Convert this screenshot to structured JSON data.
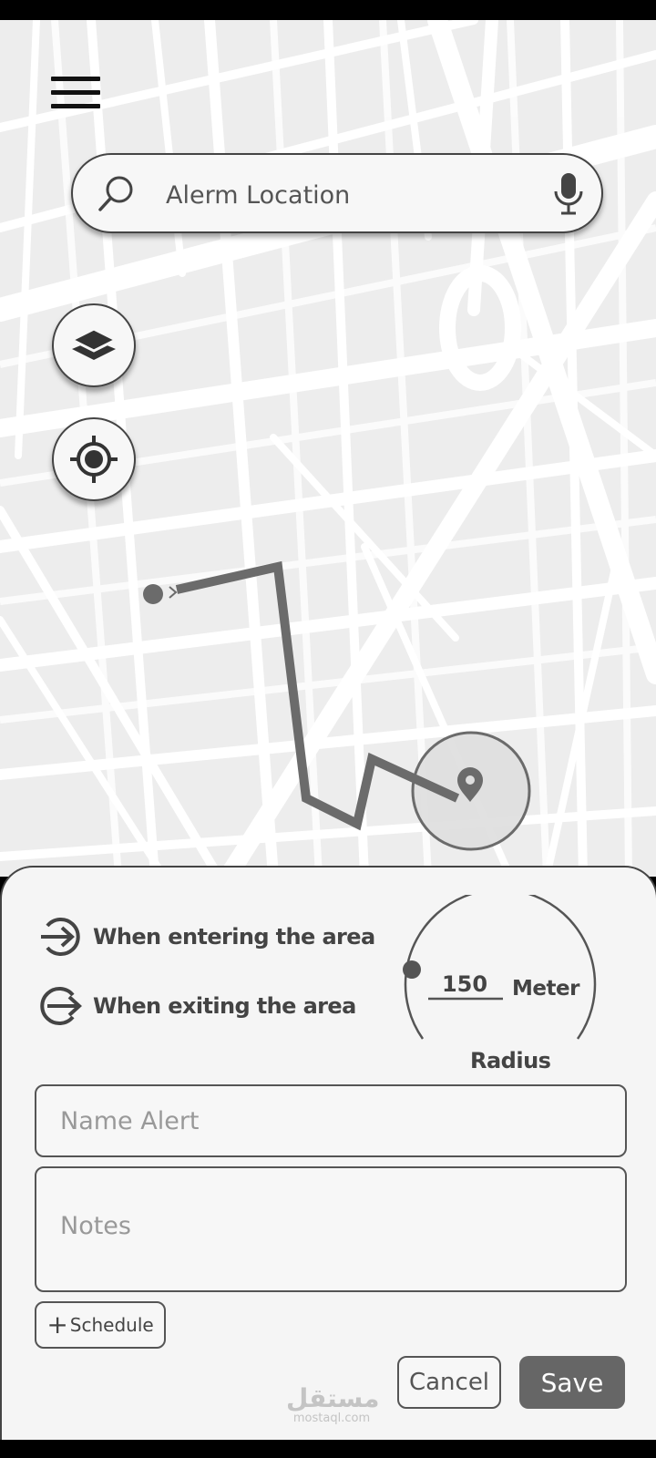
{
  "search": {
    "placeholder": "Alerm Location"
  },
  "icons": {
    "menu": "hamburger-menu-icon",
    "search": "search-icon",
    "mic": "microphone-icon",
    "layers": "layers-icon",
    "locate": "crosshair-locate-icon",
    "enter": "arrow-enter-icon",
    "exit": "arrow-exit-icon",
    "destination": "map-pin-icon"
  },
  "trigger": {
    "enter_label": "When entering the area",
    "exit_label": "When exiting the area"
  },
  "radius": {
    "value": "150",
    "unit": "Meter",
    "label": "Radius"
  },
  "form": {
    "name_placeholder": "Name Alert",
    "notes_placeholder": "Notes",
    "schedule_plus": "+",
    "schedule_label": "Schedule",
    "cancel_label": "Cancel",
    "save_label": "Save"
  },
  "watermark": {
    "arabic": "مستقل",
    "latin": "mostaql.com"
  },
  "colors": {
    "route": "#6b6b6b",
    "save_button": "#666666",
    "map_bg": "#ededed",
    "roads": "#ffffff"
  }
}
